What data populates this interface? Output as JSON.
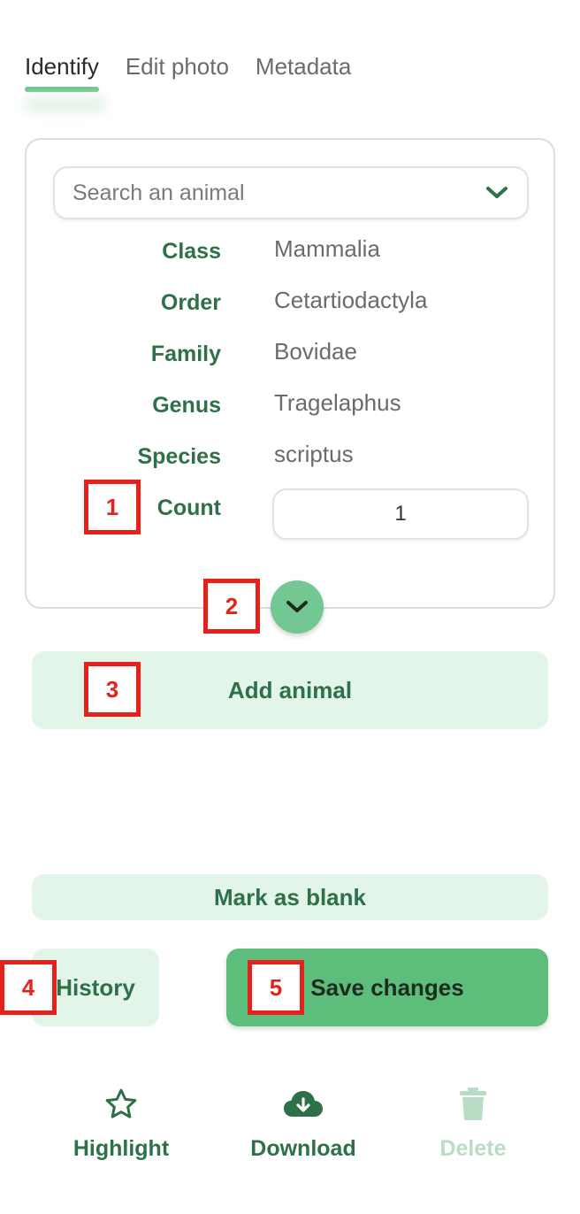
{
  "tabs": [
    {
      "label": "Identify",
      "active": true
    },
    {
      "label": "Edit photo",
      "active": false
    },
    {
      "label": "Metadata",
      "active": false
    }
  ],
  "search": {
    "placeholder": "Search an animal"
  },
  "taxonomy": [
    {
      "label": "Class",
      "value": "Mammalia"
    },
    {
      "label": "Order",
      "value": "Cetartiodactyla"
    },
    {
      "label": "Family",
      "value": "Bovidae"
    },
    {
      "label": "Genus",
      "value": "Tragelaphus"
    },
    {
      "label": "Species",
      "value": "scriptus"
    }
  ],
  "count": {
    "label": "Count",
    "value": "1"
  },
  "buttons": {
    "add_animal": "Add animal",
    "mark_blank": "Mark as blank",
    "history": "History",
    "save": "Save changes"
  },
  "annotations": [
    "1",
    "2",
    "3",
    "4",
    "5"
  ],
  "actions": [
    {
      "label": "Highlight",
      "icon": "star-icon",
      "enabled": true
    },
    {
      "label": "Download",
      "icon": "cloud-download-icon",
      "enabled": true
    },
    {
      "label": "Delete",
      "icon": "trash-icon",
      "enabled": false
    }
  ],
  "colors": {
    "primary_green": "#2e7048",
    "accent_green": "#5dbd7a",
    "light_green": "#e3f4e8",
    "annotation_red": "#e6211c"
  }
}
